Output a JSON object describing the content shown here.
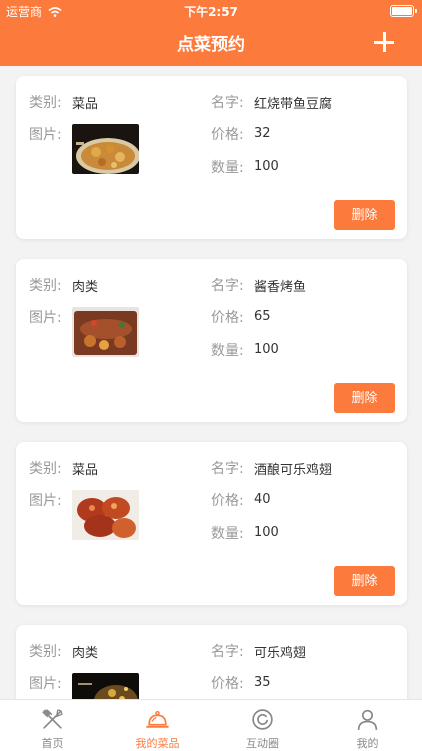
{
  "status_bar": {
    "carrier": "运营商",
    "time": "下午2:57"
  },
  "header": {
    "title": "点菜预约"
  },
  "labels": {
    "category": "类别:",
    "name": "名字:",
    "image": "图片:",
    "price": "价格:",
    "quantity": "数量:",
    "delete": "删除"
  },
  "dishes": [
    {
      "category": "菜品",
      "name": "红烧带鱼豆腐",
      "price": "32",
      "quantity": "100"
    },
    {
      "category": "肉类",
      "name": "酱香烤鱼",
      "price": "65",
      "quantity": "100"
    },
    {
      "category": "菜品",
      "name": "酒酿可乐鸡翅",
      "price": "40",
      "quantity": "100"
    },
    {
      "category": "肉类",
      "name": "可乐鸡翅",
      "price": "35"
    }
  ],
  "tabs": [
    {
      "label": "首页",
      "icon": "utensils-icon"
    },
    {
      "label": "我的菜品",
      "icon": "cloche-icon",
      "active": true
    },
    {
      "label": "互动圈",
      "icon": "circle-icon"
    },
    {
      "label": "我的",
      "icon": "user-icon"
    }
  ],
  "colors": {
    "accent": "#fd7a3d",
    "background": "#f3f3f3"
  }
}
